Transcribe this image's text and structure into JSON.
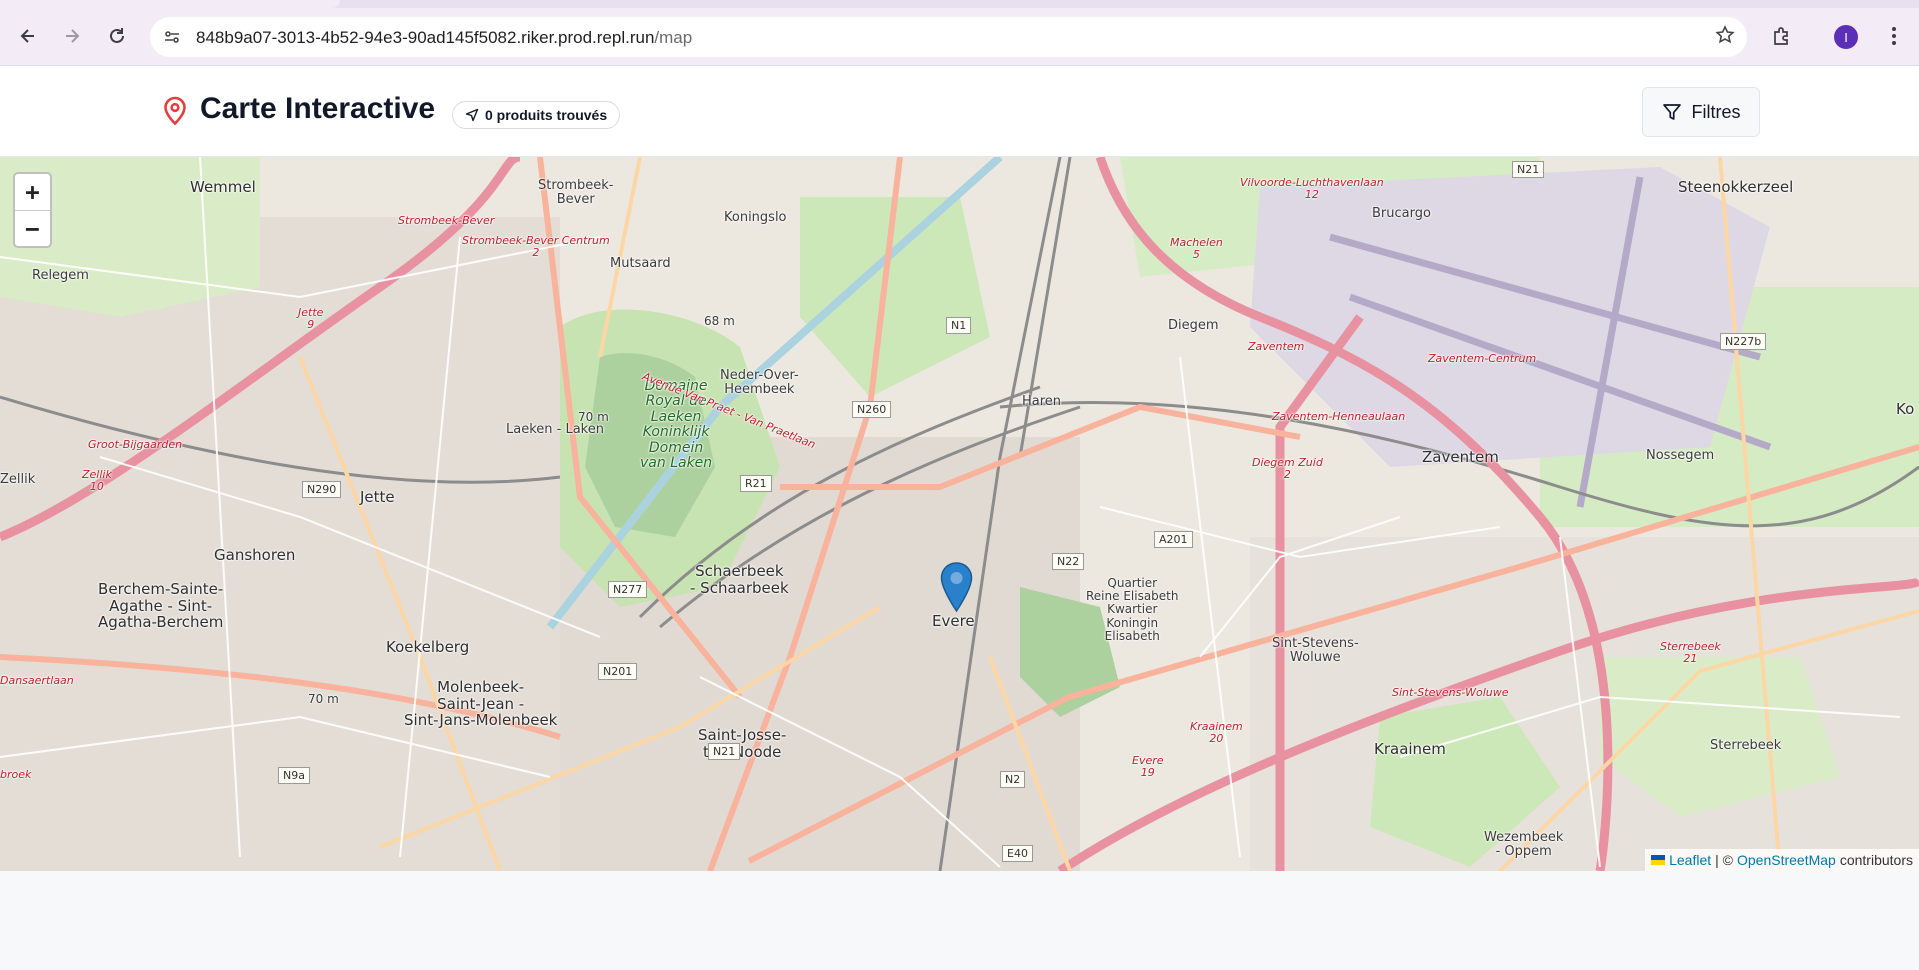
{
  "browser": {
    "url_host": "848b9a07-3013-4b52-94e3-90ad145f5082.riker.prod.repl.run",
    "url_path": "/map",
    "avatar_initial": "I",
    "icons": [
      "back-arrow-icon",
      "forward-arrow-icon",
      "reload-icon",
      "site-info-icon",
      "bookmark-star-icon",
      "extensions-icon",
      "kebab-menu-icon"
    ]
  },
  "header": {
    "title": "Carte Interactive",
    "count_badge": "0 produits trouvés",
    "filters_label": "Filtres",
    "accent_color": "#e53e3e"
  },
  "map": {
    "zoom_in": "+",
    "zoom_out": "−",
    "attribution": {
      "leaflet": "Leaflet",
      "separator": "| ©",
      "osm": "OpenStreetMap",
      "suffix": "contributors"
    },
    "place_labels": {
      "wemmel": "Wemmel",
      "strombeek_bever": "Strombeek-\nBever",
      "koningslo": "Koningslo",
      "relegem": "Relegem",
      "mutsaard": "Mutsaard",
      "neder_over_heembeek": "Neder-Over-\nHeembeek",
      "haren": "Haren",
      "diegem": "Diegem",
      "machelen": "Machelen",
      "brucargo": "Brucargo",
      "steenokkerzeel": "Steenokkerzeel",
      "zaventem": "Zaventem",
      "nossegem": "Nossegem",
      "laeken": "Laeken - Laken",
      "domaine": "Domaine\nRoyal de\nLaeken\nKoninklijk\nDomein\nvan Laken",
      "jette": "Jette",
      "ganshoren": "Ganshoren",
      "berchem": "Berchem-Sainte-\nAgathe - Sint-\nAgatha-Berchem",
      "koekelberg": "Koekelberg",
      "molenbeek": "Molenbeek-\nSaint-Jean -\nSint-Jans-Molenbeek",
      "schaerbeek": "Schaerbeek\n- Schaarbeek",
      "saint_josse": "Saint-Josse-\nten-Noode",
      "evere": "Evere",
      "quartier": "Quartier\nReine Elisabeth\nKwartier\nKoningin\nElisabeth",
      "sint_stevens_woluwe": "Sint-Stevens-\nWoluwe",
      "kraainem": "Kraainem",
      "sterrebeek": "Sterrebeek",
      "wezembeek": "Wezembeek\n- Oppem",
      "zellik": "Zellik",
      "groot_bijgaarden": "Groot-Bijgaarden",
      "ko": "Ko",
      "dansaertlaan": "Dansaertlaan",
      "broek": "broek"
    },
    "road_labels": {
      "strombeek_bever_exit": "Strombeek-Bever",
      "strombeek_centrum": "Strombeek-Bever Centrum\n2",
      "jette_exit": "Jette\n9",
      "zellik_exit": "Zellik\n10",
      "vilvoorde": "Vilvoorde-Luchthavenlaan\n12",
      "machelen_exit": "Machelen\n5",
      "zaventem_exit": "Zaventem",
      "zaventem_centrum": "Zaventem-Centrum",
      "zaventem_henneau": "Zaventem-Henneaulaan",
      "diegem_zuid": "Diegem Zuid\n2",
      "kraainem_exit": "Kraainem\n20",
      "evere_exit": "Evere\n19",
      "sint_stevens_exit": "Sint-Stevens-Woluwe",
      "sterrebeek_exit": "Sterrebeek\n21",
      "avenue": "Avenue Van Praet - Van Praetlaan"
    },
    "shields": [
      "N21",
      "N1",
      "N260",
      "R21",
      "N22",
      "A201",
      "N277",
      "N201",
      "N21",
      "N2",
      "E40",
      "N9a",
      "N290",
      "N227b"
    ],
    "elevations": [
      "68 m",
      "70 m",
      "70 m"
    ]
  }
}
